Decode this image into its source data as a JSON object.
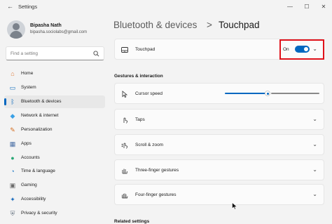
{
  "window": {
    "title": "Settings",
    "back_glyph": "←",
    "minimize_glyph": "—",
    "maximize_glyph": "☐",
    "close_glyph": "✕"
  },
  "user": {
    "name": "Bipasha Nath",
    "email": "bipasha.sociolabs@gmail.com"
  },
  "search": {
    "placeholder": "Find a setting"
  },
  "sidebar": {
    "items": [
      {
        "label": "Home",
        "icon": "home-icon",
        "glyph": "⌂",
        "color": "#e07b39",
        "active": false
      },
      {
        "label": "System",
        "icon": "display-icon",
        "glyph": "▭",
        "color": "#0f6cbd",
        "active": false
      },
      {
        "label": "Bluetooth & devices",
        "icon": "bluetooth-icon",
        "glyph": "ᛒ",
        "color": "#0f6cbd",
        "active": true
      },
      {
        "label": "Network & internet",
        "icon": "wifi-icon",
        "glyph": "◆",
        "color": "#3aa0e6",
        "active": false
      },
      {
        "label": "Personalization",
        "icon": "brush-icon",
        "glyph": "✎",
        "color": "#d46b1e",
        "active": false
      },
      {
        "label": "Apps",
        "icon": "apps-icon",
        "glyph": "▦",
        "color": "#4a6fa5",
        "active": false
      },
      {
        "label": "Accounts",
        "icon": "person-icon",
        "glyph": "●",
        "color": "#2aa876",
        "active": false
      },
      {
        "label": "Time & language",
        "icon": "globe-clock-icon",
        "glyph": "◔",
        "color": "#1f7ac6",
        "active": false
      },
      {
        "label": "Gaming",
        "icon": "gamepad-icon",
        "glyph": "▣",
        "color": "#6b6b6b",
        "active": false
      },
      {
        "label": "Accessibility",
        "icon": "accessibility-icon",
        "glyph": "✦",
        "color": "#1f6fbf",
        "active": false
      },
      {
        "label": "Privacy & security",
        "icon": "shield-icon",
        "glyph": "⛨",
        "color": "#6b7785",
        "active": false
      }
    ]
  },
  "breadcrumb": {
    "parent": "Bluetooth & devices",
    "separator": ">",
    "current": "Touchpad"
  },
  "touchpad_card": {
    "label": "Touchpad",
    "toggle_text": "On",
    "toggle_on": true
  },
  "sections": {
    "gestures_title": "Gestures & interaction",
    "related_title": "Related settings"
  },
  "cursor_speed": {
    "label": "Cursor speed",
    "value_fraction": 0.45
  },
  "gesture_cards": [
    {
      "label": "Taps",
      "icon": "tap-icon"
    },
    {
      "label": "Scroll & zoom",
      "icon": "scroll-icon"
    },
    {
      "label": "Three-finger gestures",
      "icon": "three-finger-icon"
    },
    {
      "label": "Four-finger gestures",
      "icon": "four-finger-icon"
    }
  ],
  "colors": {
    "accent": "#0067c0",
    "highlight": "#e0121b"
  }
}
